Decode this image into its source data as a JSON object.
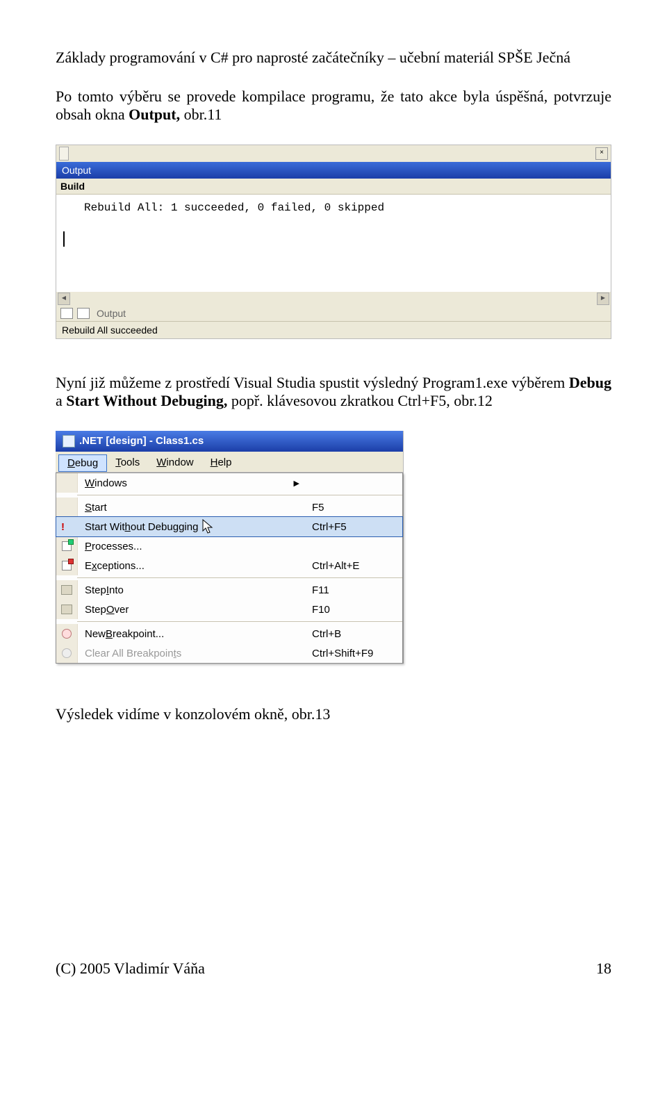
{
  "doc_header": "Základy programování v C# pro naprosté začátečníky – učební materiál SPŠE Ječná",
  "para1_a": "Po tomto výběru se provede kompilace programu, že tato akce byla úspěšná, potvrzuje obsah okna ",
  "para1_b": "Output, ",
  "para1_c": "obr.11",
  "output_panel": {
    "tab_label": "Output",
    "build_label": "Build",
    "console_text": "Rebuild All: 1 succeeded, 0 failed, 0 skipped",
    "bottom_tab": "Output",
    "status": "Rebuild All succeeded"
  },
  "para2_a": "Nyní již můžeme z prostředí Visual Studia spustit výsledný Program1.exe výběrem ",
  "para2_b": "Debug",
  "para2_c": " a ",
  "para2_d": "Start Without Debuging, ",
  "para2_e": "popř. klávesovou zkratkou Ctrl+F5, obr.12",
  "debug_menu": {
    "title": ".NET [design] - Class1.cs",
    "menubar": {
      "debug": "Debug",
      "tools": "Tools",
      "window": "Window",
      "help": "Help"
    },
    "items": [
      {
        "label": "Windows",
        "shortcut": "",
        "arrow": true
      },
      {
        "label": "Start",
        "shortcut": "F5"
      },
      {
        "label": "Start Without Debugging",
        "shortcut": "Ctrl+F5",
        "highlight": true
      },
      {
        "label": "Processes...",
        "shortcut": ""
      },
      {
        "label": "Exceptions...",
        "shortcut": "Ctrl+Alt+E"
      },
      {
        "label": "Step Into",
        "shortcut": "F11"
      },
      {
        "label": "Step Over",
        "shortcut": "F10"
      },
      {
        "label": "New Breakpoint...",
        "shortcut": "Ctrl+B"
      },
      {
        "label": "Clear All Breakpoints",
        "shortcut": "Ctrl+Shift+F9",
        "disabled": true
      }
    ]
  },
  "para3": "Výsledek vidíme v konzolovém okně, obr.13",
  "footer_left": "(C) 2005  Vladimír Váňa",
  "footer_right": "18"
}
